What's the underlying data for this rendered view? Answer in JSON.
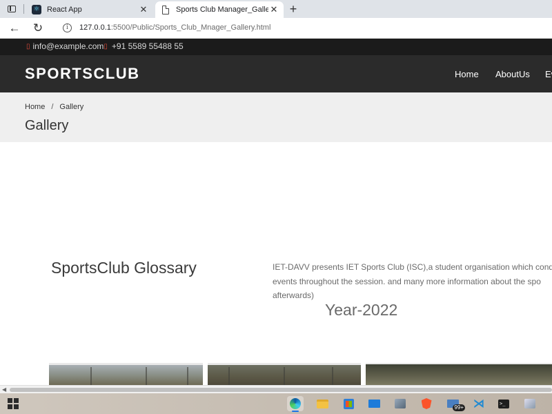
{
  "browser": {
    "tabs": [
      {
        "title": "React App",
        "favicon": "react-icon",
        "active": false
      },
      {
        "title": "Sports Club Manager_Gallery",
        "favicon": "page-icon",
        "active": true
      }
    ],
    "new_tab": "+",
    "url_host": "127.0.0.1",
    "url_rest": ":5500/Public/Sports_Club_Mnager_Gallery.html"
  },
  "topbar": {
    "email": "info@example.com",
    "phone": "+91 5589 55488 55"
  },
  "navbar": {
    "brand": "SPORTSCLUB",
    "links": [
      "Home",
      "AboutUs",
      "Ev"
    ]
  },
  "breadcrumb": {
    "home": "Home",
    "separator": "/",
    "current": "Gallery"
  },
  "page_title": "Gallery",
  "glossary": {
    "title": "SportsClub Glossary",
    "lines": [
      "IET-DAVV presents IET Sports Club (ISC),a student organisation which cond",
      "events throughout the session. and many more information about the spo",
      "afterwards)"
    ]
  },
  "year": "Year-2022",
  "taskbar": {
    "badge": "99+",
    "icons": [
      "windows-start-icon",
      "edge-icon",
      "file-explorer-icon",
      "store-icon",
      "mail-icon",
      "app-icon",
      "brave-icon",
      "notifications-icon",
      "vscode-icon",
      "terminal-icon",
      "app-icon"
    ]
  },
  "colors": {
    "topbar_bg": "#1b1b1b",
    "navbar_bg": "#2b2b2b",
    "header_bg": "#efefef",
    "accent_red": "#e24b3b"
  }
}
